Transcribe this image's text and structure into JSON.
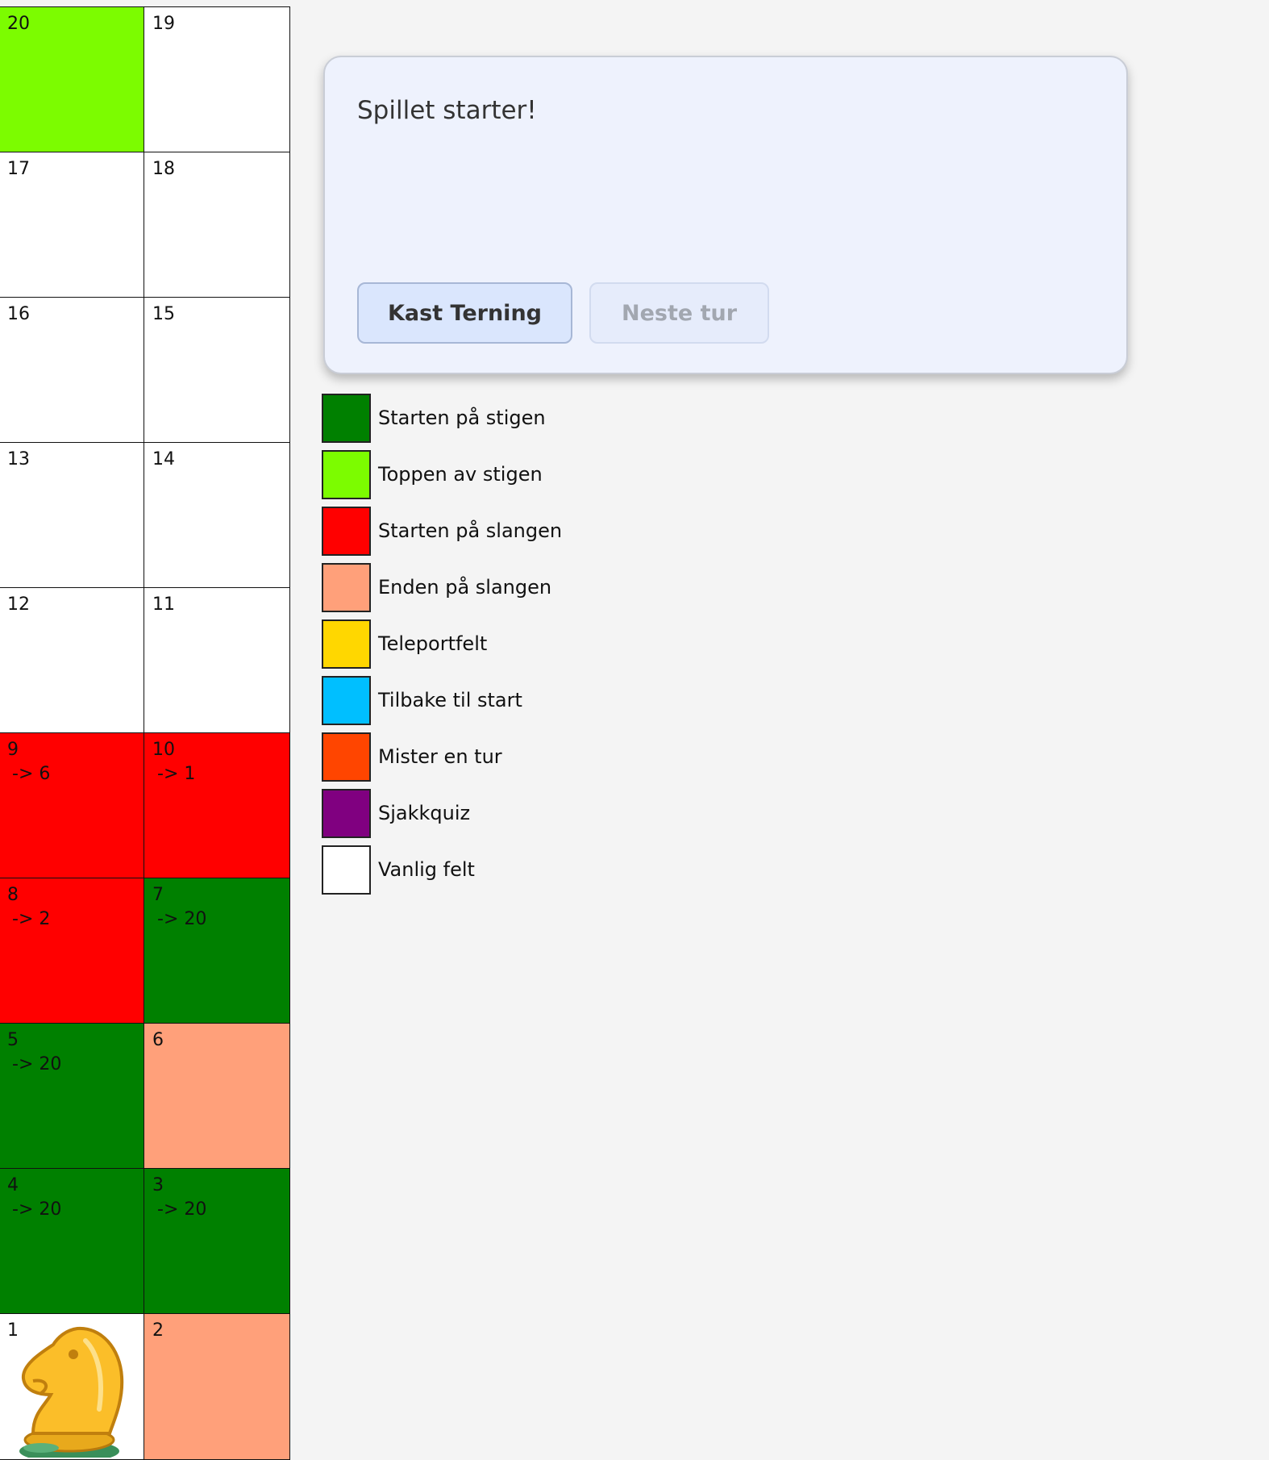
{
  "board": {
    "cells": [
      {
        "num": "20",
        "jump": "",
        "color": "#7cfc00"
      },
      {
        "num": "19",
        "jump": "",
        "color": "#ffffff"
      },
      {
        "num": "17",
        "jump": "",
        "color": "#ffffff"
      },
      {
        "num": "18",
        "jump": "",
        "color": "#ffffff"
      },
      {
        "num": "16",
        "jump": "",
        "color": "#ffffff"
      },
      {
        "num": "15",
        "jump": "",
        "color": "#ffffff"
      },
      {
        "num": "13",
        "jump": "",
        "color": "#ffffff"
      },
      {
        "num": "14",
        "jump": "",
        "color": "#ffffff"
      },
      {
        "num": "12",
        "jump": "",
        "color": "#ffffff"
      },
      {
        "num": "11",
        "jump": "",
        "color": "#ffffff"
      },
      {
        "num": "9",
        "jump": "-> 6",
        "color": "#ff0000"
      },
      {
        "num": "10",
        "jump": "-> 1",
        "color": "#ff0000"
      },
      {
        "num": "8",
        "jump": "-> 2",
        "color": "#ff0000"
      },
      {
        "num": "7",
        "jump": "-> 20",
        "color": "#008000"
      },
      {
        "num": "5",
        "jump": "-> 20",
        "color": "#008000"
      },
      {
        "num": "6",
        "jump": "",
        "color": "#ffa07a"
      },
      {
        "num": "4",
        "jump": "-> 20",
        "color": "#008000"
      },
      {
        "num": "3",
        "jump": "-> 20",
        "color": "#008000"
      },
      {
        "num": "1",
        "jump": "",
        "color": "#ffffff",
        "piece": "knight-piece-icon"
      },
      {
        "num": "2",
        "jump": "",
        "color": "#ffa07a"
      }
    ]
  },
  "panel": {
    "status": "Spillet starter!",
    "roll_button": "Kast Terning",
    "next_button": "Neste tur"
  },
  "legend": {
    "items": [
      {
        "label": "Starten på stigen",
        "color": "#008000"
      },
      {
        "label": "Toppen av stigen",
        "color": "#7cfc00"
      },
      {
        "label": "Starten på slangen",
        "color": "#ff0000"
      },
      {
        "label": "Enden på slangen",
        "color": "#ffa07a"
      },
      {
        "label": "Teleportfelt",
        "color": "#ffd700"
      },
      {
        "label": "Tilbake til start",
        "color": "#00bfff"
      },
      {
        "label": "Mister en tur",
        "color": "#ff4500"
      },
      {
        "label": "Sjakkquiz",
        "color": "#800080"
      },
      {
        "label": "Vanlig felt",
        "color": "#ffffff"
      }
    ]
  }
}
